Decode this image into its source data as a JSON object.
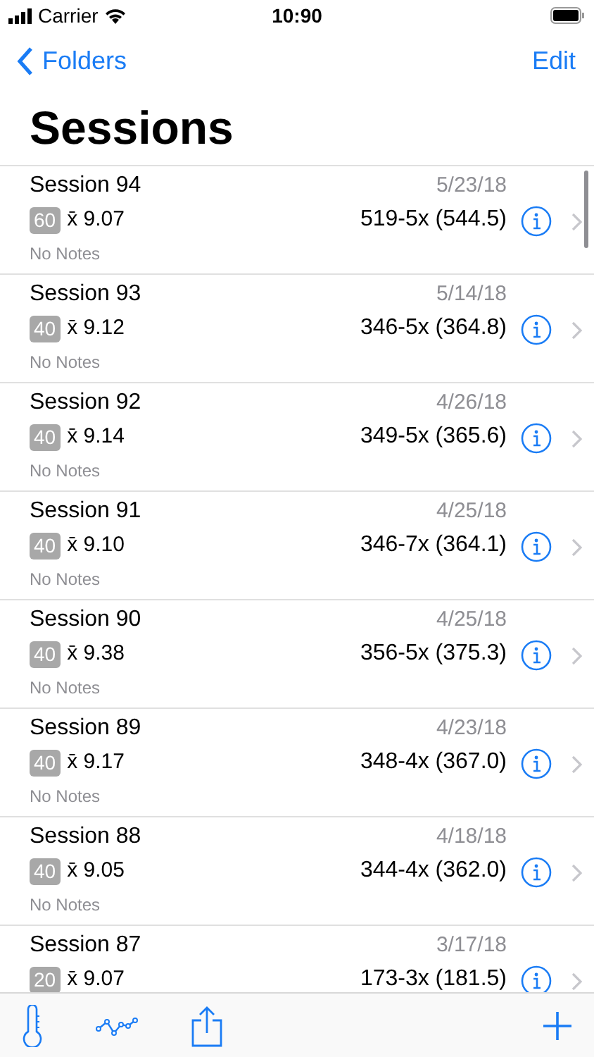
{
  "status_bar": {
    "carrier": "Carrier",
    "time": "10:90"
  },
  "nav": {
    "back": "Folders",
    "action": "Edit"
  },
  "title": "Sessions",
  "sessions": [
    {
      "name": "Session 94",
      "date": "5/23/18",
      "count": "60",
      "mean": "x̄ 9.07",
      "score": "519-5x (544.5)",
      "notes": "No Notes"
    },
    {
      "name": "Session 93",
      "date": "5/14/18",
      "count": "40",
      "mean": "x̄ 9.12",
      "score": "346-5x (364.8)",
      "notes": "No Notes"
    },
    {
      "name": "Session 92",
      "date": "4/26/18",
      "count": "40",
      "mean": "x̄ 9.14",
      "score": "349-5x (365.6)",
      "notes": "No Notes"
    },
    {
      "name": "Session 91",
      "date": "4/25/18",
      "count": "40",
      "mean": "x̄ 9.10",
      "score": "346-7x (364.1)",
      "notes": "No Notes"
    },
    {
      "name": "Session 90",
      "date": "4/25/18",
      "count": "40",
      "mean": "x̄ 9.38",
      "score": "356-5x (375.3)",
      "notes": "No Notes"
    },
    {
      "name": "Session 89",
      "date": "4/23/18",
      "count": "40",
      "mean": "x̄ 9.17",
      "score": "348-4x (367.0)",
      "notes": "No Notes"
    },
    {
      "name": "Session 88",
      "date": "4/18/18",
      "count": "40",
      "mean": "x̄ 9.05",
      "score": "344-4x (362.0)",
      "notes": "No Notes"
    },
    {
      "name": "Session 87",
      "date": "3/17/18",
      "count": "20",
      "mean": "x̄ 9.07",
      "score": "173-3x (181.5)"
    }
  ]
}
